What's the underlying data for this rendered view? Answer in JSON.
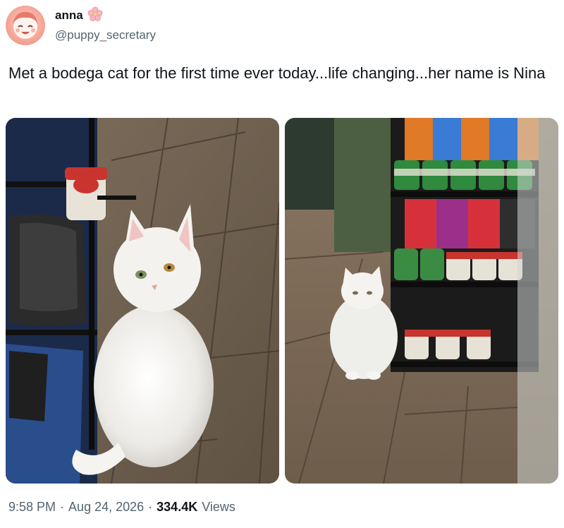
{
  "author": {
    "display_name": "anna",
    "handle": "@puppy_secretary",
    "name_emoji_icon": "cherry-blossom-icon"
  },
  "tweet": {
    "text": "Met a bodega cat for the first time ever today...life changing...her name is Nina"
  },
  "photos": [
    {
      "name": "white-cat-closeup-photo"
    },
    {
      "name": "white-cat-store-shelf-photo"
    }
  ],
  "meta": {
    "time": "9:58 PM",
    "separator": "·",
    "date": "Aug 24, 2026",
    "views_count": "334.4K",
    "views_label": "Views"
  },
  "colors": {
    "text_primary": "#0f1419",
    "text_secondary": "#536471",
    "avatar_pink": "#f6a99a"
  }
}
